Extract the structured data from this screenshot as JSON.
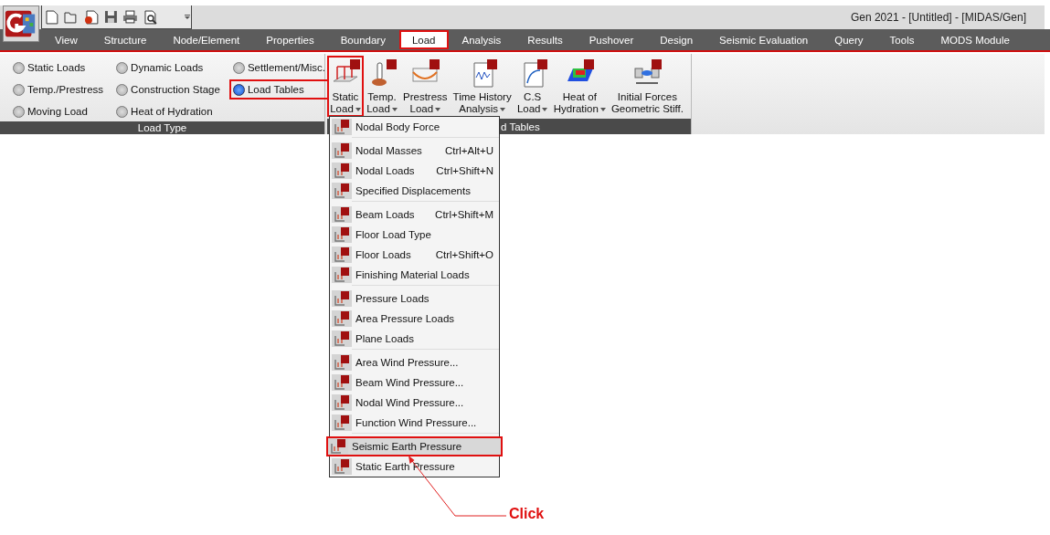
{
  "window": {
    "title": "Gen 2021 - [Untitled] - [MIDAS/Gen]"
  },
  "menu_tabs": [
    {
      "label": "View",
      "selected": false,
      "highlighted": false
    },
    {
      "label": "Structure",
      "selected": false,
      "highlighted": false
    },
    {
      "label": "Node/Element",
      "selected": false,
      "highlighted": false
    },
    {
      "label": "Properties",
      "selected": false,
      "highlighted": false
    },
    {
      "label": "Boundary",
      "selected": false,
      "highlighted": false
    },
    {
      "label": "Load",
      "selected": true,
      "highlighted": true
    },
    {
      "label": "Analysis",
      "selected": false,
      "highlighted": false
    },
    {
      "label": "Results",
      "selected": false,
      "highlighted": false
    },
    {
      "label": "Pushover",
      "selected": false,
      "highlighted": false
    },
    {
      "label": "Design",
      "selected": false,
      "highlighted": false
    },
    {
      "label": "Seismic Evaluation",
      "selected": false,
      "highlighted": false
    },
    {
      "label": "Query",
      "selected": false,
      "highlighted": false
    },
    {
      "label": "Tools",
      "selected": false,
      "highlighted": false
    },
    {
      "label": "MODS Module",
      "selected": false,
      "highlighted": false
    }
  ],
  "load_type": {
    "title": "Load Type",
    "options": [
      {
        "label": "Static Loads",
        "selected": false,
        "highlighted": false
      },
      {
        "label": "Temp./Prestress",
        "selected": false,
        "highlighted": false
      },
      {
        "label": "Moving Load",
        "selected": false,
        "highlighted": false
      },
      {
        "label": "Dynamic Loads",
        "selected": false,
        "highlighted": false
      },
      {
        "label": "Construction Stage",
        "selected": false,
        "highlighted": false
      },
      {
        "label": "Heat of Hydration",
        "selected": false,
        "highlighted": false
      },
      {
        "label": "Settlement/Misc.",
        "selected": false,
        "highlighted": false
      },
      {
        "label": "Load Tables",
        "selected": true,
        "highlighted": true
      }
    ]
  },
  "load_tables": {
    "title": "d Tables",
    "buttons": [
      {
        "lines": [
          "Static",
          "Load"
        ],
        "dropdown": true,
        "highlighted": true,
        "kind": "frame"
      },
      {
        "lines": [
          "Temp.",
          "Load"
        ],
        "dropdown": true,
        "highlighted": false,
        "kind": "thermo"
      },
      {
        "lines": [
          "Prestress",
          "Load"
        ],
        "dropdown": true,
        "highlighted": false,
        "kind": "tendon"
      },
      {
        "lines": [
          "Time History",
          "Analysis"
        ],
        "dropdown": true,
        "highlighted": false,
        "kind": "graph"
      },
      {
        "lines": [
          "C.S",
          "Load"
        ],
        "dropdown": true,
        "highlighted": false,
        "kind": "curve"
      },
      {
        "lines": [
          "Heat of",
          "Hydration"
        ],
        "dropdown": true,
        "highlighted": false,
        "kind": "heat"
      },
      {
        "lines": [
          "Initial Forces",
          "Geometric Stiff."
        ],
        "dropdown": false,
        "highlighted": false,
        "kind": "force"
      }
    ]
  },
  "static_load_menu": {
    "sections": [
      [
        {
          "label": "Nodal Body Force",
          "highlighted": false
        }
      ],
      [
        {
          "label": "Nodal Masses",
          "shortcut": "Ctrl+Alt+U",
          "highlighted": false
        },
        {
          "label": "Nodal Loads",
          "shortcut": "Ctrl+Shift+N",
          "highlighted": false
        },
        {
          "label": "Specified Displacements",
          "highlighted": false
        }
      ],
      [
        {
          "label": "Beam Loads",
          "shortcut": "Ctrl+Shift+M",
          "highlighted": false
        },
        {
          "label": "Floor Load Type",
          "highlighted": false
        },
        {
          "label": "Floor Loads",
          "shortcut": "Ctrl+Shift+O",
          "highlighted": false
        },
        {
          "label": "Finishing Material Loads",
          "highlighted": false
        }
      ],
      [
        {
          "label": "Pressure Loads",
          "highlighted": false
        },
        {
          "label": "Area Pressure Loads",
          "highlighted": false
        },
        {
          "label": "Plane Loads",
          "highlighted": false
        }
      ],
      [
        {
          "label": "Area Wind Pressure...",
          "highlighted": false
        },
        {
          "label": "Beam Wind Pressure...",
          "highlighted": false
        },
        {
          "label": "Nodal Wind Pressure...",
          "highlighted": false
        },
        {
          "label": "Function Wind Pressure...",
          "highlighted": false
        }
      ],
      [
        {
          "label": "Seismic Earth Pressure",
          "highlighted": true
        },
        {
          "label": "Static Earth Pressure",
          "highlighted": false
        }
      ]
    ]
  },
  "annotation": {
    "label": "Click"
  }
}
